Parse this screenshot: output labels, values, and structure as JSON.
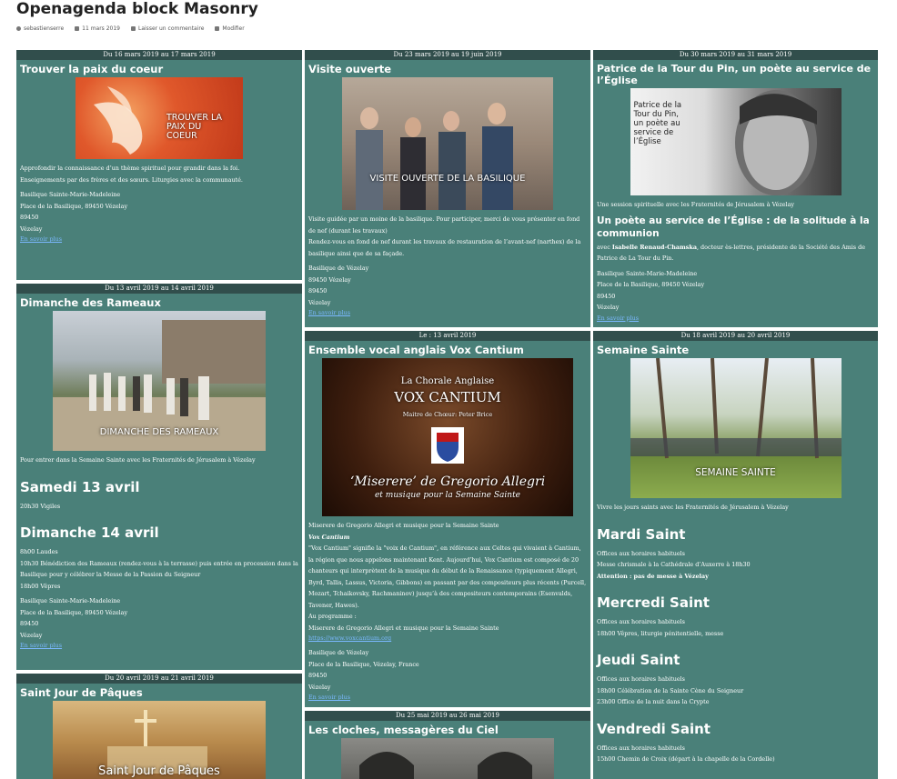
{
  "page": {
    "title": "Openagenda block Masonry",
    "meta": {
      "author": "sebastienserre",
      "date": "11 mars 2019",
      "comment": "Laisser un commentaire",
      "edit": "Modifier"
    }
  },
  "link_label": "En savoir plus",
  "cards": {
    "paix": {
      "date": "Du 16 mars 2019 au 17 mars 2019",
      "title": "Trouver la paix du coeur",
      "image_caption": "TROUVER LA\nPAIX DU\nCOEUR",
      "desc1": "Approfondir la connaissance d’un thème spirituel pour grandir dans la foi.",
      "desc2": "Enseignements par des frères et des sœurs. Liturgies avec la communauté.",
      "addr1": "Basilique Sainte-Marie-Madeleine",
      "addr2": "Place de la Basilique, 89450 Vézelay",
      "addr3": "89450",
      "addr4": "Vézelay"
    },
    "rameaux": {
      "date": "Du 13 avril 2019 au 14 avril 2019",
      "title": "Dimanche des Rameaux",
      "image_caption": "DIMANCHE DES RAMEAUX",
      "desc": "Pour entrer dans la Semaine Sainte avec les Fraternités de Jérusalem à Vézelay",
      "h_sam": "Samedi 13 avril",
      "sam1": "20h30 Vigiles",
      "h_dim": "Dimanche 14 avril",
      "dim1": "8h00 Laudes",
      "dim2": "10h30 Bénédiction des Rameaux (rendez-vous à la terrasse) puis entrée en procession dans la Basilique pour y célébrer la Messe de la Passion du Seigneur",
      "dim3": "18h00 Vêpres",
      "addr1": "Basilique Sainte-Marie-Madeleine",
      "addr2": "Place de la Basilique, 89450 Vézelay",
      "addr3": "89450",
      "addr4": "Vézelay"
    },
    "paques": {
      "date": "Du 20 avril 2019 au 21 avril 2019",
      "title": "Saint Jour de Pâques",
      "image_caption": "Saint Jour de Pâques"
    },
    "visite": {
      "date": "Du 23 mars 2019 au 19 juin 2019",
      "title": "Visite ouverte",
      "image_caption": "VISITE OUVERTE DE LA BASILIQUE",
      "desc1": "Visite guidée par un moine de la basilique. Pour participer, merci de vous présenter en fond de nef (durant les travaux)",
      "desc2": "Rendez-vous en fond de nef durant les travaux de restauration de l’avant-nef (narthex) de la basilique ainsi que de sa façade.",
      "addr1": "Basilique de Vézelay",
      "addr2": "89450 Vézelay",
      "addr3": "89450",
      "addr4": "Vézelay"
    },
    "vox": {
      "date": "Le : 13 avril 2019",
      "title": "Ensemble vocal anglais Vox Cantium",
      "img_l1": "La Chorale Anglaise",
      "img_l2": "VOX CANTIUM",
      "img_l3": "Maitre de Chœur: Peter Brice",
      "img_l4": "‘Miserere’ de Gregorio Allegri",
      "img_l5": "et musique pour la Semaine Sainte",
      "desc1": "Miserere de Gregorio Allegri et musique pour la Semaine Sainte",
      "bold_title": "Vox Cantium",
      "desc2": "\"Vox Cantium\" signifie la \"voix de Cantium\", en référence aux Celtes qui vivaient à Cantium, la région que nous appelons maintenant Kent. Aujourd’hui, Vox Cantium est composé de 20 chanteurs qui interprètent de la musique du début de la Renaissance (typiquement Allegri, Byrd, Tallis, Lassus, Victoria, Gibbons) en passant par des compositeurs plus récents (Purcell, Mozart, Tchaikovsky, Rachmaninov) jusqu’à des compositeurs contemporains (Esenvalds, Tavener, Hawes).",
      "prog_label": "Au programme :",
      "prog": "Miserere de Gregorio Allegri et musique pour la Semaine Sainte",
      "url": "https://www.voxcantium.org",
      "addr1": "Basilique de Vézelay",
      "addr2": "Place de la Basilique, Vézelay, France",
      "addr3": "89450",
      "addr4": "Vézelay"
    },
    "cloches": {
      "date": "Du 25 mai 2019 au 26 mai 2019",
      "title": "Les cloches, messagères du Ciel"
    },
    "patrice": {
      "date": "Du 30 mars 2019 au 31 mars 2019",
      "title": "Patrice de la Tour du Pin, un poète au service de l’Église",
      "image_caption": "Patrice de la\nTour du Pin,\nun poète au\nservice de\nl’Église",
      "desc1": "Une session spirituelle avec les Fraternités de Jérusalem à Vézelay",
      "subtitle": "Un poète au service de l’Église : de la solitude à la communion",
      "avec": "avec ",
      "speaker": "Isabelle Renaud-Chamska",
      "speaker_rest": ", docteur ès-lettres, présidente de la Société des Amis de Patrice de La Tour du Pin.",
      "addr1": "Basilique Sainte-Marie-Madeleine",
      "addr2": "Place de la Basilique, 89450 Vézelay",
      "addr3": "89450",
      "addr4": "Vézelay"
    },
    "semaine": {
      "date": "Du 18 avril 2019 au 20 avril 2019",
      "title": "Semaine Sainte",
      "image_caption": "SEMAINE SAINTE",
      "desc": "Vivre les jours saints avec les Fraternités de Jérusalem à Vézelay",
      "h_mardi": "Mardi Saint",
      "mardi1": "Offices aux horaires habituels",
      "mardi2": "Messe chrismale à la Cathédrale d’Auxerre à 18h30",
      "mardi3": "Attention : pas de messe à Vézelay",
      "h_mercredi": "Mercredi Saint",
      "mercredi1": "Offices aux horaires habituels",
      "mercredi2": "18h00 Vêpres, liturgie pénitentielle, messe",
      "h_jeudi": "Jeudi Saint",
      "jeudi1": "Offices aux horaires habituels",
      "jeudi2": "18h00 Célébration de la Sainte Cène du Seigneur",
      "jeudi3": "23h00 Office de la nuit dans la Crypte",
      "h_vendredi": "Vendredi Saint",
      "vendredi1": "Offices aux horaires habituels",
      "vendredi2": "15h00 Chemin de Croix (départ à la chapelle de la Cordelle)"
    }
  }
}
